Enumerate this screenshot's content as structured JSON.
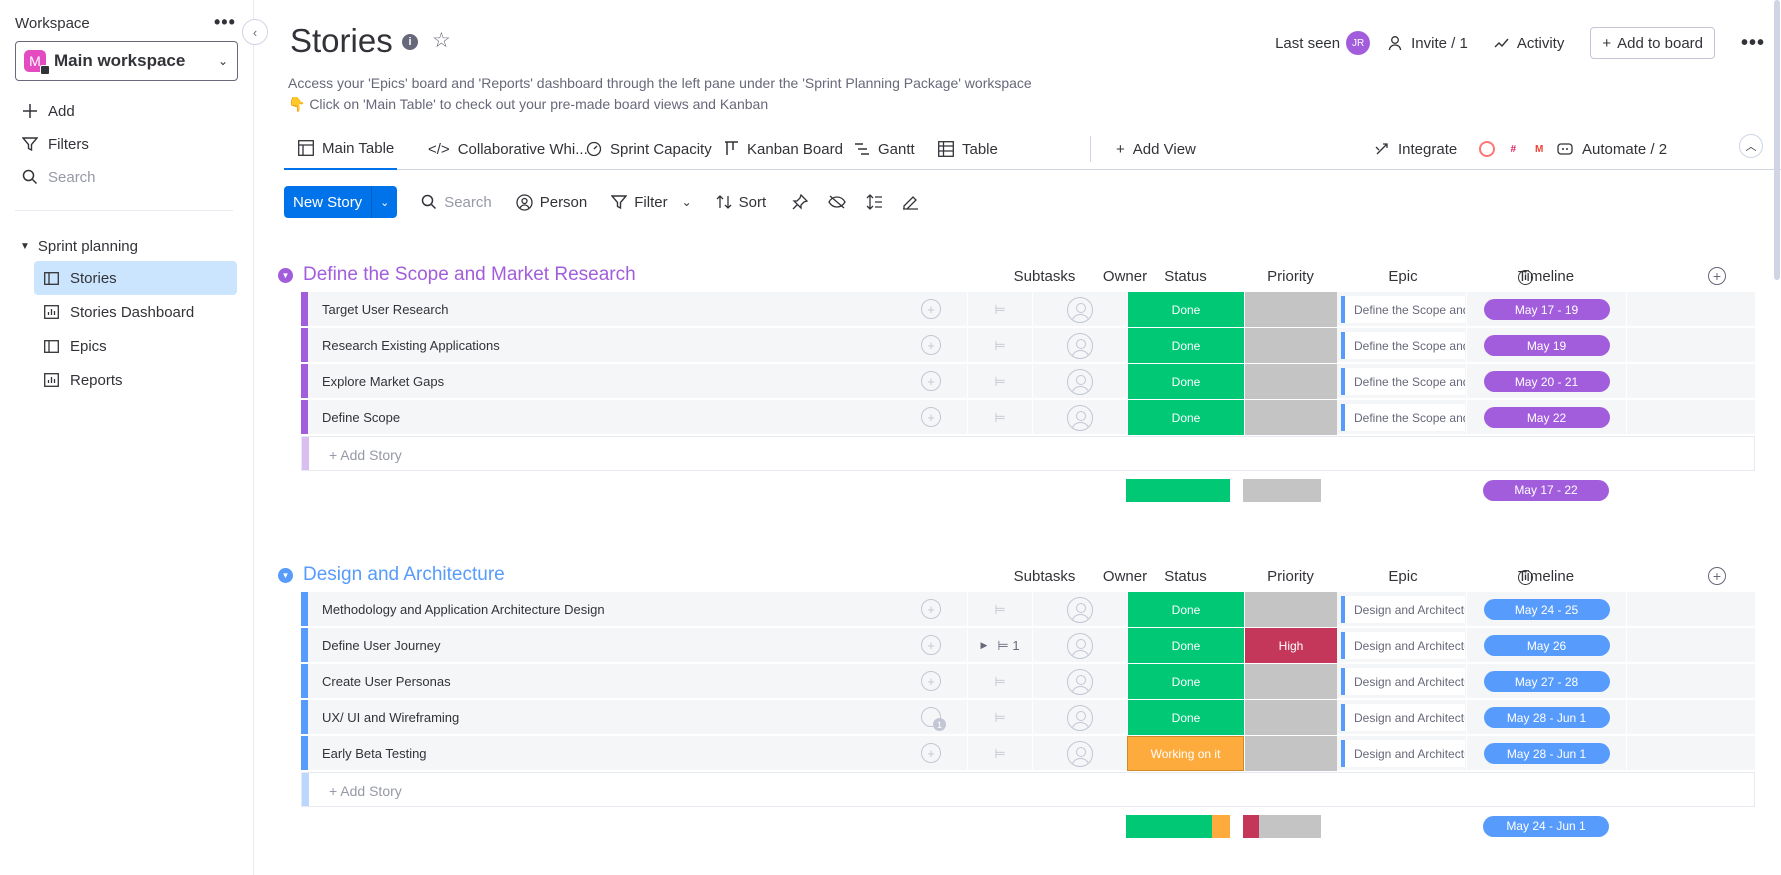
{
  "sidebar": {
    "workspace_label": "Workspace",
    "workspace_name": "Main workspace",
    "workspace_initial": "M",
    "actions": {
      "add": "Add",
      "filters": "Filters",
      "search_placeholder": "Search"
    },
    "folder": "Sprint planning",
    "items": [
      {
        "label": "Stories",
        "icon": "board-icon",
        "active": true
      },
      {
        "label": "Stories Dashboard",
        "icon": "dashboard-icon",
        "active": false
      },
      {
        "label": "Epics",
        "icon": "board-icon",
        "active": false
      },
      {
        "label": "Reports",
        "icon": "dashboard-icon",
        "active": false
      }
    ]
  },
  "header": {
    "title": "Stories",
    "desc_line1": "Access your 'Epics' board and 'Reports' dashboard through the left pane under the 'Sprint Planning Package' workspace",
    "desc_line2": "👇 Click on 'Main Table' to check out your pre-made board views and Kanban",
    "last_seen": "Last seen",
    "avatar_initials": "JR",
    "invite": "Invite / 1",
    "activity": "Activity",
    "add_to_board": "Add to board"
  },
  "tabs": {
    "items": [
      "Main Table",
      "Collaborative Whi...",
      "Sprint Capacity",
      "Kanban Board",
      "Gantt",
      "Table"
    ],
    "add_view": "Add View",
    "integrate": "Integrate",
    "automate": "Automate / 2"
  },
  "toolbar": {
    "new_story": "New Story",
    "search": "Search",
    "person": "Person",
    "filter": "Filter",
    "sort": "Sort"
  },
  "columns": {
    "subtasks": "Subtasks",
    "owner": "Owner",
    "status": "Status",
    "priority": "Priority",
    "epic": "Epic",
    "timeline": "Timeline"
  },
  "colors": {
    "done": "#00c875",
    "working": "#fdab3d",
    "high": "#c4375a",
    "empty": "#c4c4c4",
    "group1": "#a25ddc",
    "group2": "#579bfc",
    "accent": "#0073ea"
  },
  "groups": [
    {
      "title": "Define the Scope and Market Research",
      "color": "#a25ddc",
      "add_label": "+ Add Story",
      "summary_timeline": "May 17 - 22",
      "rows": [
        {
          "name": "Target User Research",
          "status": "Done",
          "priority": "",
          "epic": "Define the Scope and Market Research",
          "timeline": "May 17 - 19"
        },
        {
          "name": "Research Existing Applications",
          "status": "Done",
          "priority": "",
          "epic": "Define the Scope and Market Research",
          "timeline": "May 19"
        },
        {
          "name": "Explore Market Gaps",
          "status": "Done",
          "priority": "",
          "epic": "Define the Scope and Market Research",
          "timeline": "May 20 - 21"
        },
        {
          "name": "Define Scope",
          "status": "Done",
          "priority": "",
          "epic": "Define the Scope and Market Research",
          "timeline": "May 22"
        }
      ]
    },
    {
      "title": "Design and Architecture",
      "color": "#579bfc",
      "add_label": "+ Add Story",
      "summary_timeline": "May 24 - Jun 1",
      "rows": [
        {
          "name": "Methodology and Application Architecture Design",
          "status": "Done",
          "priority": "",
          "epic": "Design and Architecture",
          "timeline": "May 24 - 25"
        },
        {
          "name": "Define User Journey",
          "status": "Done",
          "priority": "High",
          "epic": "Design and Architecture",
          "timeline": "May 26",
          "subtasks": "1"
        },
        {
          "name": "Create User Personas",
          "status": "Done",
          "priority": "",
          "epic": "Design and Architecture",
          "timeline": "May 27 - 28"
        },
        {
          "name": "UX/ UI and Wireframing",
          "status": "Done",
          "priority": "",
          "epic": "Design and Architecture",
          "timeline": "May 28 - Jun 1",
          "updates": "1"
        },
        {
          "name": "Early Beta Testing",
          "status": "Working on it",
          "priority": "",
          "epic": "Design and Architecture",
          "timeline": "May 28 - Jun 1"
        }
      ]
    }
  ]
}
